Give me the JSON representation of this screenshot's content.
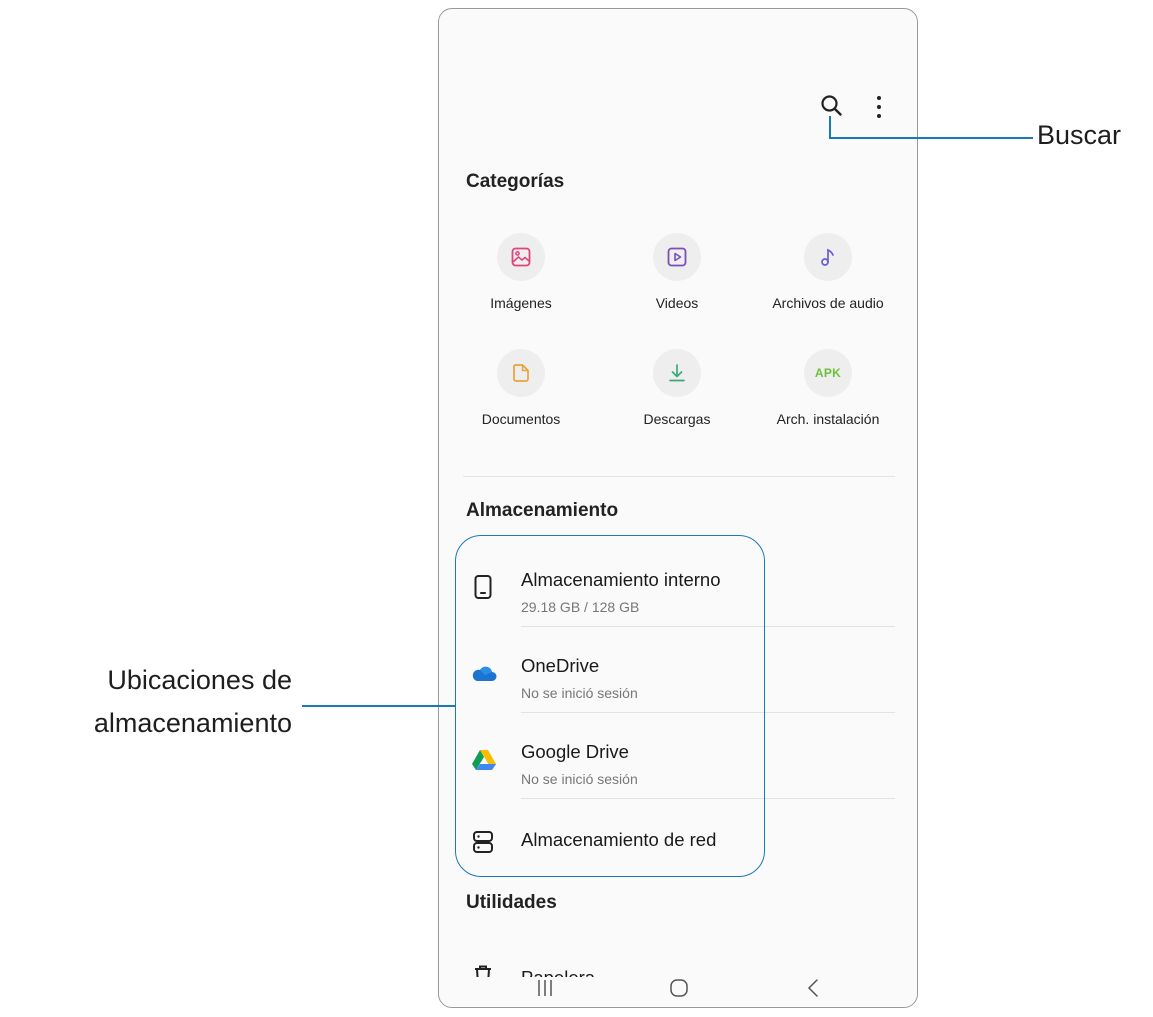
{
  "toolbar": {
    "search_icon": "search-icon",
    "more_icon": "more-options-icon"
  },
  "categories": {
    "title": "Categorías",
    "items": [
      {
        "label": "Imágenes",
        "icon": "image-icon",
        "color": "#e0457b"
      },
      {
        "label": "Videos",
        "icon": "video-icon",
        "color": "#7b4fb8"
      },
      {
        "label": "Archivos de audio",
        "icon": "music-note-icon",
        "color": "#6a5cd6"
      },
      {
        "label": "Documentos",
        "icon": "document-icon",
        "color": "#e9a23b"
      },
      {
        "label": "Descargas",
        "icon": "download-icon",
        "color": "#3aa978"
      },
      {
        "label": "Arch. instalación",
        "icon_text": "APK",
        "icon": "apk-icon",
        "color": "#6cbf3b"
      }
    ]
  },
  "storage": {
    "title": "Almacenamiento",
    "items": [
      {
        "title": "Almacenamiento interno",
        "subtitle": "29.18 GB / 128 GB",
        "icon": "phone-icon"
      },
      {
        "title": "OneDrive",
        "subtitle": "No se inició sesión",
        "icon": "onedrive-cloud-icon"
      },
      {
        "title": "Google Drive",
        "subtitle": "No se inició sesión",
        "icon": "google-drive-icon"
      },
      {
        "title": "Almacenamiento de red",
        "icon": "network-storage-icon"
      }
    ]
  },
  "utilities": {
    "title": "Utilidades",
    "items": [
      {
        "title": "Papelera",
        "icon": "trash-icon"
      }
    ]
  },
  "nav": {
    "recents": "recents-icon",
    "home": "home-icon",
    "back": "back-icon"
  },
  "callouts": {
    "search": "Buscar",
    "storage_line1": "Ubicaciones de",
    "storage_line2": "almacenamiento",
    "color": "#1a7ab8"
  }
}
